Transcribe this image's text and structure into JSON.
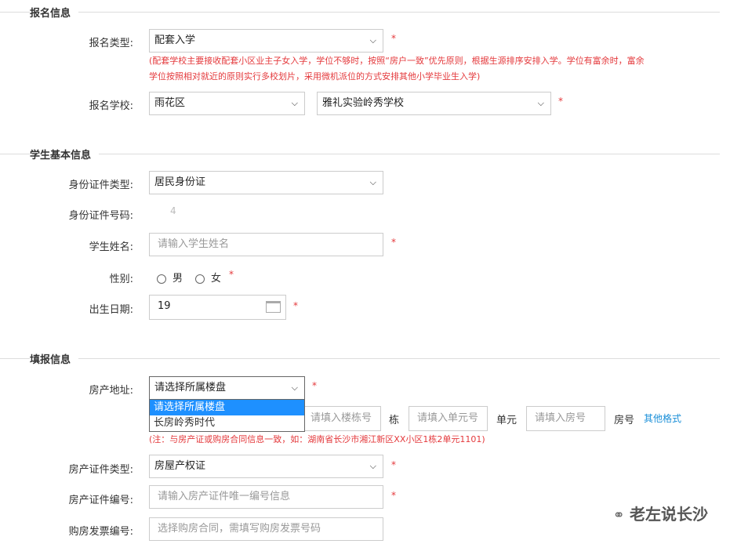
{
  "sections": {
    "reg": "报名信息",
    "student": "学生基本信息",
    "fill": "填报信息"
  },
  "reg": {
    "type_label": "报名类型:",
    "type_value": "配套入学",
    "note": "(配套学校主要接收配套小区业主子女入学，学位不够时，按照“房户一致”优先原则，根据生源排序安排入学。学位有富余时，富余学位按照相对就近的原则实行多校划片，采用微机派位的方式安排其他小学毕业生入学)",
    "school_label": "报名学校:",
    "district": "雨花区",
    "school": "雅礼实验岭秀学校"
  },
  "student": {
    "id_type_label": "身份证件类型:",
    "id_type": "居民身份证",
    "id_no_label": "身份证件号码:",
    "id_no": "4",
    "name_label": "学生姓名:",
    "name_placeholder": "请输入学生姓名",
    "gender_label": "性别:",
    "male": "男",
    "female": "女",
    "dob_label": "出生日期:",
    "dob": "19"
  },
  "fill": {
    "address_label": "房产地址:",
    "estate": "请选择所属楼盘",
    "options": [
      "请选择所属楼盘",
      "长房岭秀时代"
    ],
    "building_placeholder": "请填入楼栋号",
    "building_unit": "栋",
    "unit_placeholder": "请填入单元号",
    "unit_unit": "单元",
    "room_placeholder": "请填入房号",
    "room_unit": "房号",
    "other_format": "其他格式",
    "address_note": "(注：与房产证或购房合同信息一致，如：湖南省长沙市湘江新区XX小区1栋2单元1101)",
    "cert_type_label": "房产证件类型:",
    "cert_type": "房屋产权证",
    "cert_no_label": "房产证件编号:",
    "cert_no_placeholder": "请输入房产证件唯一编号信息",
    "invoice_label": "购房发票编号:",
    "invoice_placeholder": "选择购房合同，需填写购房发票号码"
  },
  "required": "*",
  "watermark": "老左说长沙",
  "colors": {
    "required": "#e4393c",
    "link": "#1a8fd8",
    "selected": "#1e90ff"
  }
}
